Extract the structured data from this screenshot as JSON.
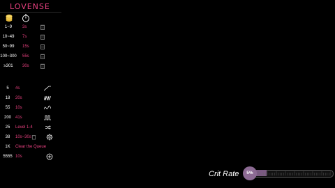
{
  "app": {
    "logo": "LOVENSE"
  },
  "coin_rows": [
    {
      "tokens": "1~9",
      "duration": "3s"
    },
    {
      "tokens": "10~49",
      "duration": "7s"
    },
    {
      "tokens": "50~99",
      "duration": "15s"
    },
    {
      "tokens": "100~300",
      "duration": "55s"
    },
    {
      "tokens": "≥301",
      "duration": "30s"
    }
  ],
  "special_rows": [
    {
      "tokens": "5",
      "duration": "4s",
      "icon": "pattern-ramp-icon"
    },
    {
      "tokens": "18",
      "duration": "20s",
      "icon": "pattern-wave-icon"
    },
    {
      "tokens": "55",
      "duration": "10s",
      "icon": "pattern-pulse-icon"
    },
    {
      "tokens": "200",
      "duration": "41s",
      "icon": "pattern-square-icon"
    },
    {
      "tokens": "25",
      "duration": "Level 1-4",
      "icon": "shuffle-icon"
    },
    {
      "tokens": "38",
      "duration": "10s~30s",
      "icon": "gear-icon"
    },
    {
      "tokens": "1K",
      "duration": "Clear the Queue",
      "icon": ""
    },
    {
      "tokens": "5555",
      "duration": "10s",
      "icon": "plus-circle-icon"
    }
  ],
  "crit": {
    "label": "Crit Rate",
    "value": "5%",
    "percent": 5
  },
  "colors": {
    "accent": "#e7407f",
    "slider": "#8c6a93",
    "background": "#000000"
  }
}
